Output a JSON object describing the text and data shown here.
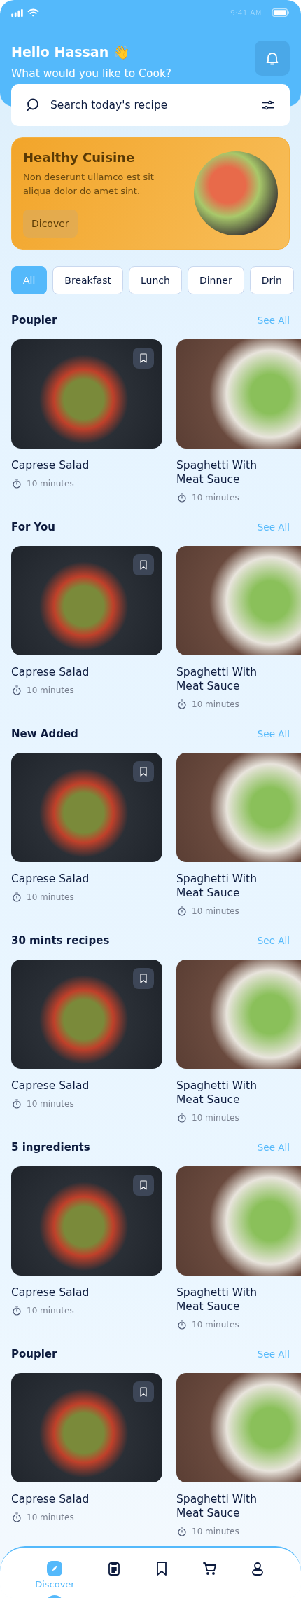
{
  "status_bar": {
    "time": "9:41 AM"
  },
  "header": {
    "greeting": "Hello Hassan 👋",
    "subtitle": "What would you like to Cook?"
  },
  "search": {
    "placeholder": "Search today's recipe"
  },
  "banner": {
    "title": "Healthy Cuisine",
    "text": "Non deserunt ullamco est sit aliqua dolor do amet sint.",
    "button": "Dicover"
  },
  "categories": [
    {
      "label": "All",
      "selected": true
    },
    {
      "label": "Breakfast",
      "selected": false
    },
    {
      "label": "Lunch",
      "selected": false
    },
    {
      "label": "Dinner",
      "selected": false
    },
    {
      "label": "Drin",
      "selected": false
    }
  ],
  "sections": [
    {
      "title": "Poupler",
      "link": "See All",
      "recipes": [
        {
          "name": "Caprese Salad",
          "time": "10 minutes",
          "bookmark": true
        },
        {
          "name": "Spaghetti With Meat Sauce",
          "time": "10 minutes",
          "bookmark": false
        }
      ]
    },
    {
      "title": "For You",
      "link": "See All",
      "recipes": [
        {
          "name": "Caprese Salad",
          "time": "10 minutes",
          "bookmark": true
        },
        {
          "name": "Spaghetti With Meat Sauce",
          "time": "10 minutes",
          "bookmark": false
        }
      ]
    },
    {
      "title": "New Added",
      "link": "See All",
      "recipes": [
        {
          "name": "Caprese Salad",
          "time": "10 minutes",
          "bookmark": true
        },
        {
          "name": "Spaghetti With Meat Sauce",
          "time": "10 minutes",
          "bookmark": false
        }
      ]
    },
    {
      "title": "30 mints recipes",
      "link": "See All",
      "recipes": [
        {
          "name": "Caprese Salad",
          "time": "10 minutes",
          "bookmark": true
        },
        {
          "name": "Spaghetti With Meat Sauce",
          "time": "10 minutes",
          "bookmark": false
        }
      ]
    },
    {
      "title": "5 ingredients",
      "link": "See All",
      "recipes": [
        {
          "name": "Caprese Salad",
          "time": "10 minutes",
          "bookmark": true
        },
        {
          "name": "Spaghetti With Meat Sauce",
          "time": "10 minutes",
          "bookmark": false
        }
      ]
    },
    {
      "title": "Poupler",
      "link": "See All",
      "recipes": [
        {
          "name": "Caprese Salad",
          "time": "10 minutes",
          "bookmark": true
        },
        {
          "name": "Spaghetti With Meat Sauce",
          "time": "10 minutes",
          "bookmark": false
        }
      ]
    }
  ],
  "nav": [
    {
      "kind": "compass",
      "label": "Discover",
      "selected": true
    },
    {
      "kind": "clipboard",
      "selected": false
    },
    {
      "kind": "bookmark",
      "selected": false
    },
    {
      "kind": "cart",
      "selected": false
    },
    {
      "kind": "user",
      "selected": false
    }
  ]
}
